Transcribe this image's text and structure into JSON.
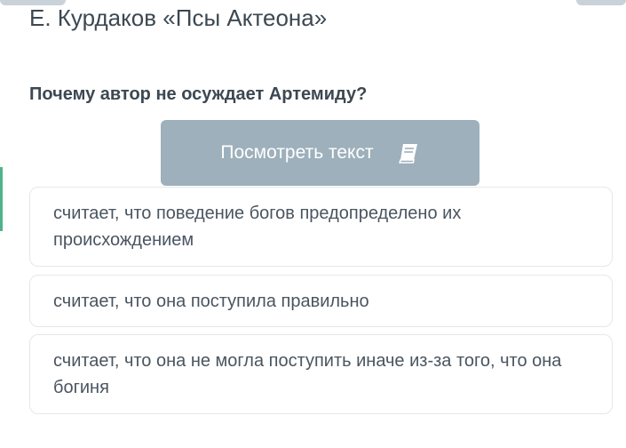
{
  "header": {
    "work_title": "Е. Курдаков «Псы Актеона»"
  },
  "question": {
    "text": "Почему автор не осуждает Артемиду?"
  },
  "view_text_button": {
    "label": "Посмотреть текст",
    "icon": "book-icon"
  },
  "answers": [
    {
      "text": "считает, что поведение богов предопределено их происхождением"
    },
    {
      "text": "считает, что она поступила правильно"
    },
    {
      "text": "считает, что она не могла поступить иначе из-за того, что она богиня"
    }
  ],
  "colors": {
    "button_bg": "#9db0bb",
    "text_dark": "#3c4852",
    "answer_border": "#e3e8eb",
    "accent_green": "#4fb389"
  }
}
